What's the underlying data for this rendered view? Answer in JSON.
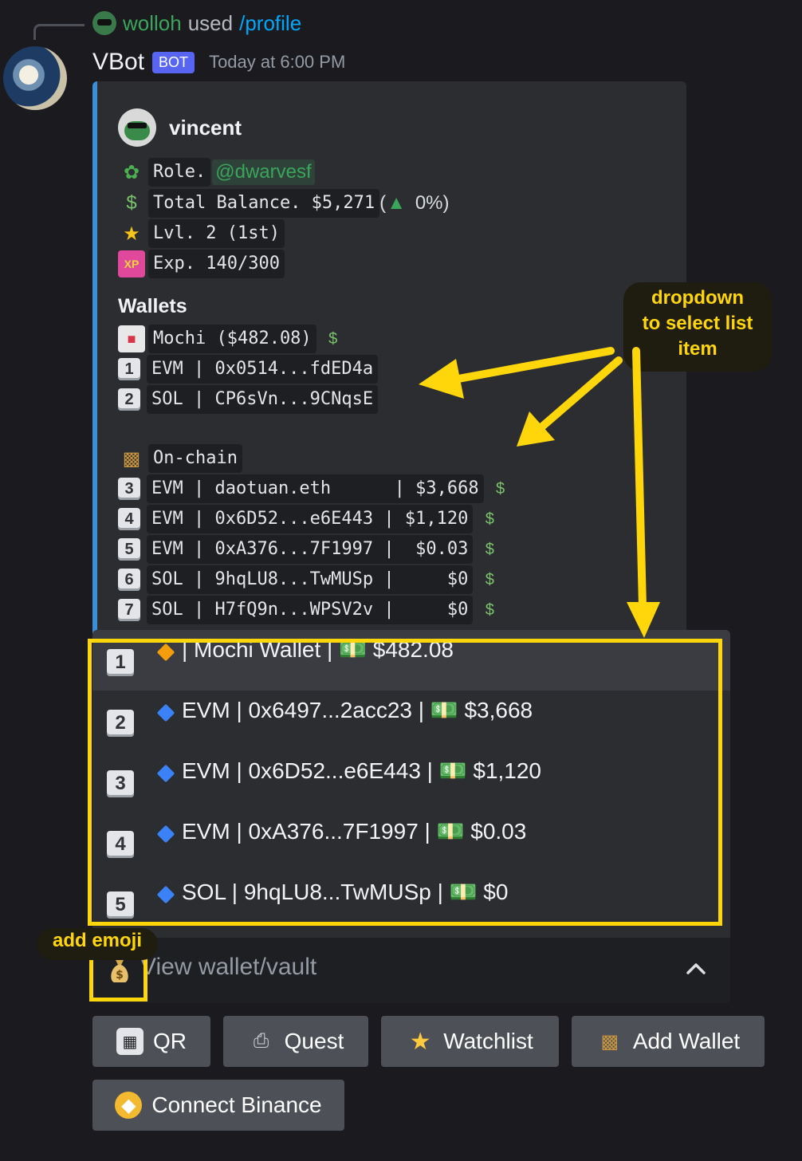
{
  "reply": {
    "user": "wolloh",
    "text": "used",
    "command": "/profile"
  },
  "author": {
    "name": "VBot",
    "badge": "BOT",
    "timestamp": "Today at 6:00 PM"
  },
  "embed": {
    "author_name": "vincent",
    "accent_color": "#3b8fd9",
    "profile_lines": [
      {
        "icon": "leaf-icon",
        "code": "Role.",
        "mention": "@dwarvesf"
      },
      {
        "icon": "cash-icon",
        "code": "Total Balance. $5,271",
        "suffix": "(",
        "trend_icon": "up-arrow-icon",
        "suffix2": " 0%)"
      },
      {
        "icon": "medal-icon",
        "code": "Lvl. 2 (1st)"
      },
      {
        "icon": "xp-icon",
        "code": "Exp. 140/300"
      }
    ],
    "wallets_heading": "Wallets",
    "mochi_line": {
      "icon": "mochi-icon",
      "code": "Mochi ($482.08)"
    },
    "wallet_lines": [
      {
        "key": "1",
        "code": "EVM | 0x0514...fdED4a"
      },
      {
        "key": "2",
        "code": "SOL | CP6sVn...9CNqsE"
      }
    ],
    "onchain_line": {
      "icon": "wallet-icon",
      "code": "On-chain"
    },
    "onchain_lines": [
      {
        "key": "3",
        "code": "EVM | daotuan.eth      | $3,668"
      },
      {
        "key": "4",
        "code": "EVM | 0x6D52...e6E443 | $1,120"
      },
      {
        "key": "5",
        "code": "EVM | 0xA376...7F1997 |  $0.03"
      },
      {
        "key": "6",
        "code": "SOL | 9hqLU8...TwMUSp |     $0"
      },
      {
        "key": "7",
        "code": "SOL | H7fQ9n...WPSV2v |     $0"
      }
    ]
  },
  "dropdown": {
    "options": [
      {
        "key": "1",
        "diamond": "orange",
        "label": "| Mochi Wallet | 💵 $482.08"
      },
      {
        "key": "2",
        "diamond": "blue",
        "label": "EVM | 0x6497...2acc23 | 💵 $3,668"
      },
      {
        "key": "3",
        "diamond": "blue",
        "label": "EVM | 0x6D52...e6E443 | 💵 $1,120"
      },
      {
        "key": "4",
        "diamond": "blue",
        "label": "EVM | 0xA376...7F1997 | 💵 $0.03"
      },
      {
        "key": "5",
        "diamond": "blue",
        "label": "SOL | 9hqLU8...TwMUSp | 💵 $0"
      }
    ],
    "placeholder": "View wallet/vault",
    "placeholder_icon": "money-bag-icon"
  },
  "buttons": [
    {
      "label": "QR",
      "icon": "qr-icon"
    },
    {
      "label": "Quest",
      "icon": "printer-icon"
    },
    {
      "label": "Watchlist",
      "icon": "star-icon"
    },
    {
      "label": "Add Wallet",
      "icon": "wallet-icon"
    },
    {
      "label": "Connect Binance",
      "icon": "binance-icon"
    }
  ],
  "annotations": {
    "dropdown_note": [
      "dropdown",
      "to select list",
      "item"
    ],
    "emoji_note": "add emoji",
    "color": "#ffd60a"
  }
}
